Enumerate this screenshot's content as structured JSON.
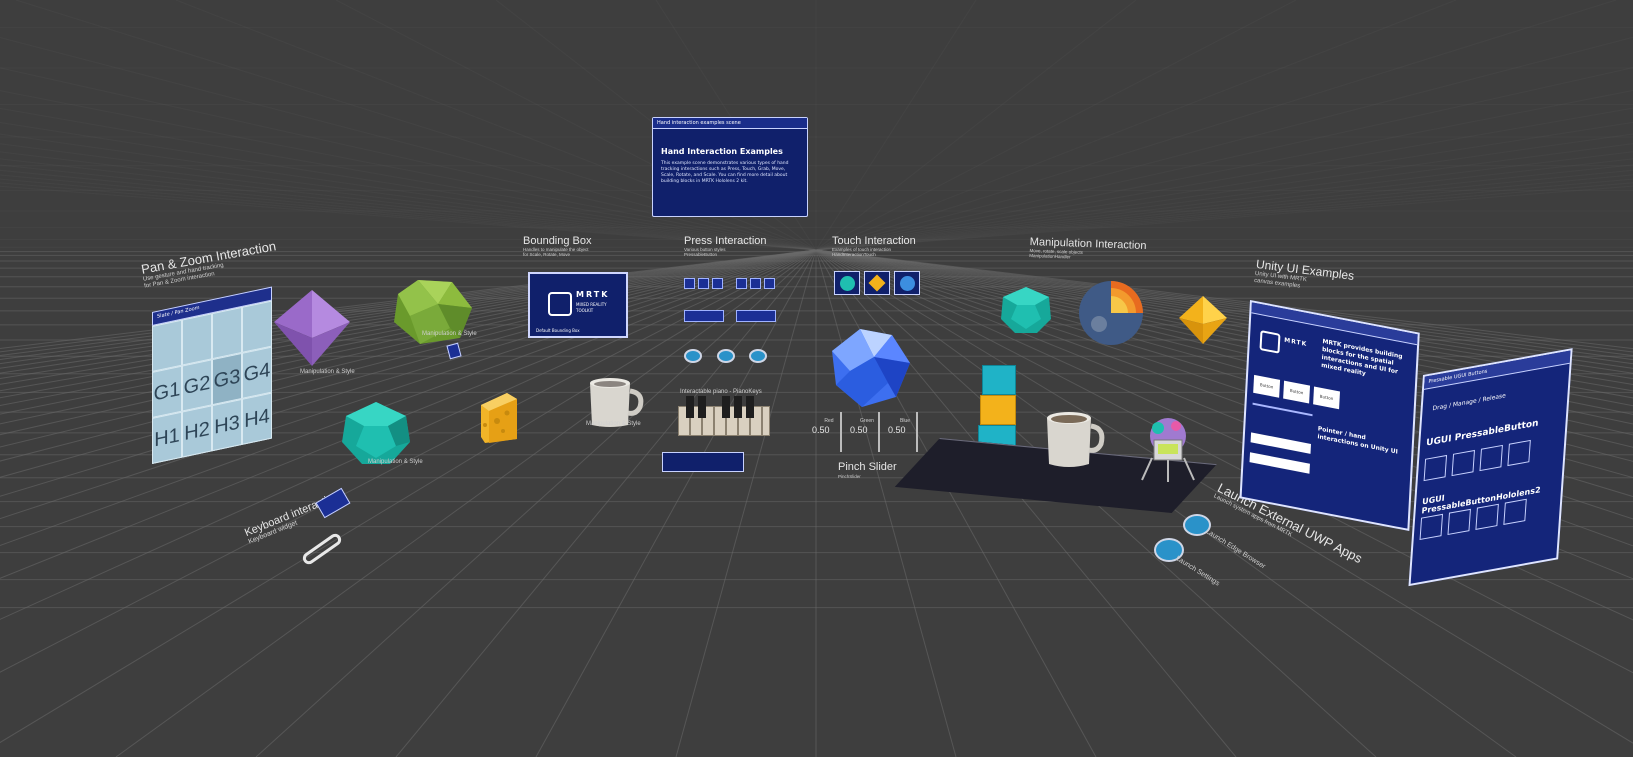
{
  "top_panel": {
    "header": "Hand interaction examples scene",
    "title": "Hand Interaction Examples",
    "body": "This example scene demonstrates various types of hand tracking interactions such as Press, Touch, Grab, Move, Scale, Rotate, and Scale. You can find more detail about building blocks in MRTK Hololens 2 kit."
  },
  "sections": {
    "pan_zoom": {
      "title": "Pan & Zoom Interaction",
      "sub1": "Use gesture and hand tracking",
      "sub2": "for Pan & Zoom interaction"
    },
    "bounding_box": {
      "title": "Bounding Box",
      "sub1": "Handles to manipulate the object",
      "sub2": "for Scale, Rotate, Move"
    },
    "press": {
      "title": "Press Interaction",
      "sub1": "Various button styles",
      "sub2": "PressableButton"
    },
    "touch": {
      "title": "Touch Interaction",
      "sub1": "Examples of touch interaction",
      "sub2": "HandInteractionTouch"
    },
    "manipulation": {
      "title": "Manipulation Interaction",
      "sub1": "Move, rotate, scale objects",
      "sub2": "ManipulationHandler"
    },
    "unity_ui": {
      "title": "Unity UI Examples",
      "sub1": "Unity UI with MRTK",
      "sub2": "canvas examples"
    },
    "keyboard": {
      "title": "Keyboard interaction",
      "sub1": "Keyboard widget"
    },
    "pinch_slider": {
      "title": "Pinch Slider",
      "sub1": "PinchSlider"
    },
    "launch_apps": {
      "title": "Launch External UWP Apps",
      "sub1": "Launch system apps from MRTK"
    }
  },
  "bounding_box_card": {
    "logo": "MRTK",
    "line1": "MIXED REALITY",
    "line2": "TOOLKIT",
    "footer": "Default Bounding Box"
  },
  "grid_tiles": [
    "G1",
    "G2",
    "G3",
    "G4",
    "H1",
    "H2",
    "H3",
    "H4"
  ],
  "grid_header": "Slate / Pan Zoom",
  "object_labels": {
    "octahedron": "Manipulation & Style",
    "icosahedron": "Manipulation & Style",
    "dodeca_left": "Manipulation & Style",
    "mug_center": "Manipulation & Style",
    "piano": "Interactable piano - PianoKeys"
  },
  "sliders": [
    {
      "label": "Red",
      "value": "0.50"
    },
    {
      "label": "Green",
      "value": "0.50"
    },
    {
      "label": "Blue",
      "value": "0.50"
    }
  ],
  "unity_panel": {
    "brand": "MRTK",
    "headline": "MRTK provides building blocks for the spatial interactions and UI for mixed reality",
    "tabs": [
      "Button",
      "Button",
      "Button"
    ],
    "subhead": "Pointer / hand interactions on Unity UI"
  },
  "right_panel": {
    "header": "Pressable UGUI Buttons",
    "row1": "Drag / Manage / Release",
    "h1": "UGUI PressableButton",
    "h2": "UGUI PressableButtonHololens2"
  },
  "launchers": [
    {
      "label": "Launch Edge Browser"
    },
    {
      "label": "Launch Settings"
    }
  ],
  "colors": {
    "background": "#3e3e3e",
    "panel": "#10206b",
    "teal": "#1fbfb0",
    "purple": "#a070d0",
    "green": "#7aaa3a",
    "gold": "#f3b21b",
    "blue": "#2a92c9"
  }
}
